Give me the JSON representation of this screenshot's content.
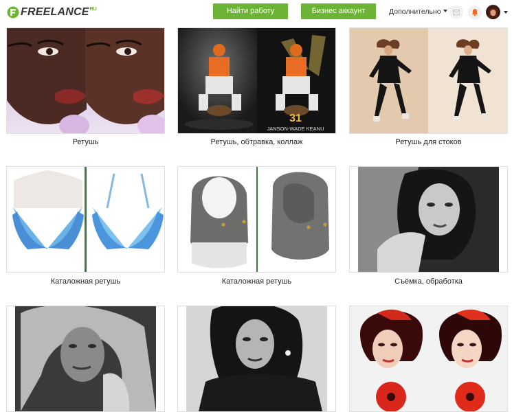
{
  "header": {
    "logo_text": "FREELANCE",
    "logo_suffix": "RU",
    "find_work_label": "Найти работу",
    "business_label": "Бизнес аккаунт",
    "more_label": "Дополнительно"
  },
  "colors": {
    "brand_green": "#6db335",
    "notification_orange": "#f26b21"
  },
  "icons": {
    "mail": "mail-icon",
    "bell": "bell-icon",
    "dropdown": "chevron-down-icon"
  },
  "gallery": {
    "items": [
      {
        "caption": "Ретушь",
        "image": "before-after portrait close-up"
      },
      {
        "caption": "Ретушь, обтравка, коллаж",
        "image": "baseball catcher composite"
      },
      {
        "caption": "Ретушь для стоков",
        "image": "dancer in black on beige"
      },
      {
        "caption": "Каталожная ретушь",
        "image": "blue bra product shot"
      },
      {
        "caption": "Каталожная ретушь",
        "image": "grey knitted balaclava"
      },
      {
        "caption": "Съёмка, обработка",
        "image": "black and white portrait"
      },
      {
        "caption": "",
        "image": "black and white curly-haired woman"
      },
      {
        "caption": "",
        "image": "black and white portrait with gloves"
      },
      {
        "caption": "",
        "image": "red hair with red flower before-after"
      }
    ],
    "collage_text": "JANSON-WADE KEANU",
    "collage_number": "31"
  }
}
